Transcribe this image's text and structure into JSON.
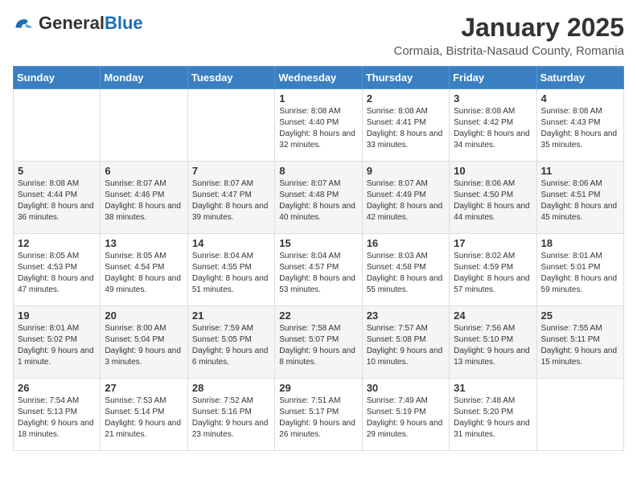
{
  "header": {
    "logo_general": "General",
    "logo_blue": "Blue",
    "title": "January 2025",
    "subtitle": "Cormaia, Bistrita-Nasaud County, Romania"
  },
  "weekdays": [
    "Sunday",
    "Monday",
    "Tuesday",
    "Wednesday",
    "Thursday",
    "Friday",
    "Saturday"
  ],
  "weeks": [
    [
      {
        "day": "",
        "info": ""
      },
      {
        "day": "",
        "info": ""
      },
      {
        "day": "",
        "info": ""
      },
      {
        "day": "1",
        "info": "Sunrise: 8:08 AM\nSunset: 4:40 PM\nDaylight: 8 hours and 32 minutes."
      },
      {
        "day": "2",
        "info": "Sunrise: 8:08 AM\nSunset: 4:41 PM\nDaylight: 8 hours and 33 minutes."
      },
      {
        "day": "3",
        "info": "Sunrise: 8:08 AM\nSunset: 4:42 PM\nDaylight: 8 hours and 34 minutes."
      },
      {
        "day": "4",
        "info": "Sunrise: 8:08 AM\nSunset: 4:43 PM\nDaylight: 8 hours and 35 minutes."
      }
    ],
    [
      {
        "day": "5",
        "info": "Sunrise: 8:08 AM\nSunset: 4:44 PM\nDaylight: 8 hours and 36 minutes."
      },
      {
        "day": "6",
        "info": "Sunrise: 8:07 AM\nSunset: 4:46 PM\nDaylight: 8 hours and 38 minutes."
      },
      {
        "day": "7",
        "info": "Sunrise: 8:07 AM\nSunset: 4:47 PM\nDaylight: 8 hours and 39 minutes."
      },
      {
        "day": "8",
        "info": "Sunrise: 8:07 AM\nSunset: 4:48 PM\nDaylight: 8 hours and 40 minutes."
      },
      {
        "day": "9",
        "info": "Sunrise: 8:07 AM\nSunset: 4:49 PM\nDaylight: 8 hours and 42 minutes."
      },
      {
        "day": "10",
        "info": "Sunrise: 8:06 AM\nSunset: 4:50 PM\nDaylight: 8 hours and 44 minutes."
      },
      {
        "day": "11",
        "info": "Sunrise: 8:06 AM\nSunset: 4:51 PM\nDaylight: 8 hours and 45 minutes."
      }
    ],
    [
      {
        "day": "12",
        "info": "Sunrise: 8:05 AM\nSunset: 4:53 PM\nDaylight: 8 hours and 47 minutes."
      },
      {
        "day": "13",
        "info": "Sunrise: 8:05 AM\nSunset: 4:54 PM\nDaylight: 8 hours and 49 minutes."
      },
      {
        "day": "14",
        "info": "Sunrise: 8:04 AM\nSunset: 4:55 PM\nDaylight: 8 hours and 51 minutes."
      },
      {
        "day": "15",
        "info": "Sunrise: 8:04 AM\nSunset: 4:57 PM\nDaylight: 8 hours and 53 minutes."
      },
      {
        "day": "16",
        "info": "Sunrise: 8:03 AM\nSunset: 4:58 PM\nDaylight: 8 hours and 55 minutes."
      },
      {
        "day": "17",
        "info": "Sunrise: 8:02 AM\nSunset: 4:59 PM\nDaylight: 8 hours and 57 minutes."
      },
      {
        "day": "18",
        "info": "Sunrise: 8:01 AM\nSunset: 5:01 PM\nDaylight: 8 hours and 59 minutes."
      }
    ],
    [
      {
        "day": "19",
        "info": "Sunrise: 8:01 AM\nSunset: 5:02 PM\nDaylight: 9 hours and 1 minute."
      },
      {
        "day": "20",
        "info": "Sunrise: 8:00 AM\nSunset: 5:04 PM\nDaylight: 9 hours and 3 minutes."
      },
      {
        "day": "21",
        "info": "Sunrise: 7:59 AM\nSunset: 5:05 PM\nDaylight: 9 hours and 6 minutes."
      },
      {
        "day": "22",
        "info": "Sunrise: 7:58 AM\nSunset: 5:07 PM\nDaylight: 9 hours and 8 minutes."
      },
      {
        "day": "23",
        "info": "Sunrise: 7:57 AM\nSunset: 5:08 PM\nDaylight: 9 hours and 10 minutes."
      },
      {
        "day": "24",
        "info": "Sunrise: 7:56 AM\nSunset: 5:10 PM\nDaylight: 9 hours and 13 minutes."
      },
      {
        "day": "25",
        "info": "Sunrise: 7:55 AM\nSunset: 5:11 PM\nDaylight: 9 hours and 15 minutes."
      }
    ],
    [
      {
        "day": "26",
        "info": "Sunrise: 7:54 AM\nSunset: 5:13 PM\nDaylight: 9 hours and 18 minutes."
      },
      {
        "day": "27",
        "info": "Sunrise: 7:53 AM\nSunset: 5:14 PM\nDaylight: 9 hours and 21 minutes."
      },
      {
        "day": "28",
        "info": "Sunrise: 7:52 AM\nSunset: 5:16 PM\nDaylight: 9 hours and 23 minutes."
      },
      {
        "day": "29",
        "info": "Sunrise: 7:51 AM\nSunset: 5:17 PM\nDaylight: 9 hours and 26 minutes."
      },
      {
        "day": "30",
        "info": "Sunrise: 7:49 AM\nSunset: 5:19 PM\nDaylight: 9 hours and 29 minutes."
      },
      {
        "day": "31",
        "info": "Sunrise: 7:48 AM\nSunset: 5:20 PM\nDaylight: 9 hours and 31 minutes."
      },
      {
        "day": "",
        "info": ""
      }
    ]
  ]
}
